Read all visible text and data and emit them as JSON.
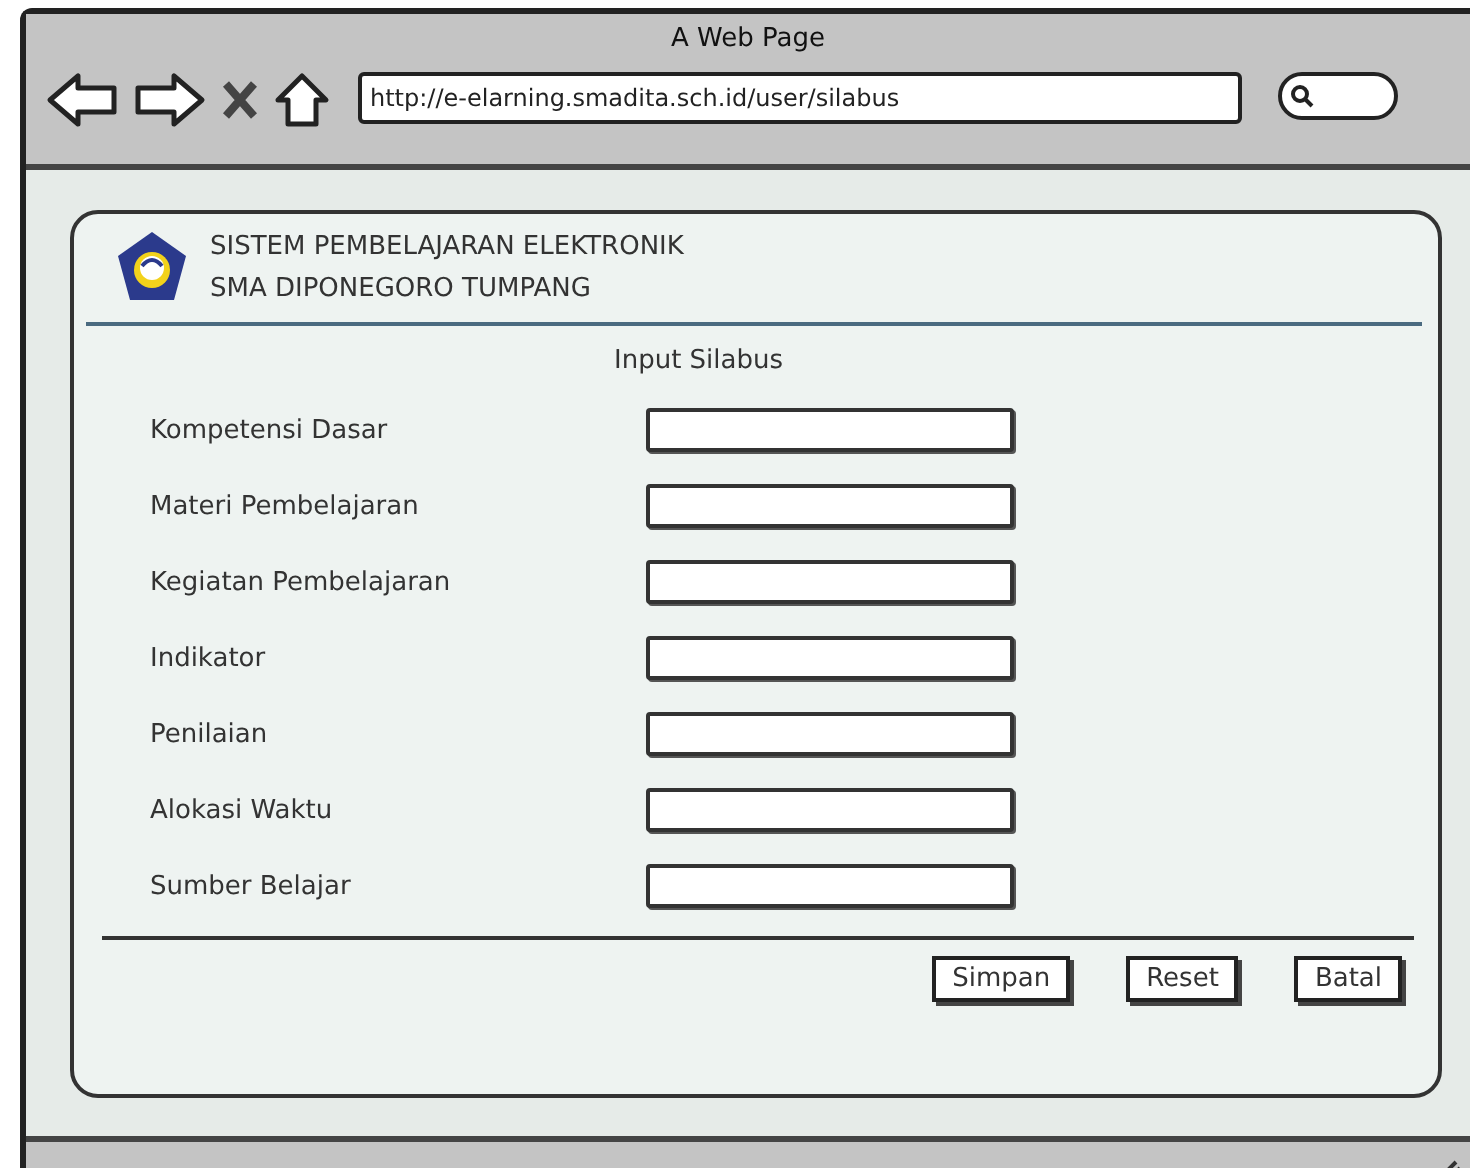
{
  "window": {
    "title": "A Web Page"
  },
  "address_bar": {
    "url": "http://e-elarning.smadita.sch.id/user/silabus"
  },
  "header": {
    "title": "SISTEM PEMBELAJARAN ELEKTRONIK",
    "subtitle": "SMA DIPONEGORO TUMPANG"
  },
  "form": {
    "title": "Input Silabus",
    "fields": [
      {
        "label": "Kompetensi Dasar"
      },
      {
        "label": "Materi Pembelajaran"
      },
      {
        "label": "Kegiatan Pembelajaran"
      },
      {
        "label": "Indikator"
      },
      {
        "label": "Penilaian"
      },
      {
        "label": "Alokasi Waktu"
      },
      {
        "label": "Sumber Belajar"
      }
    ],
    "buttons": [
      "Simpan",
      "Reset",
      "Batal"
    ]
  }
}
